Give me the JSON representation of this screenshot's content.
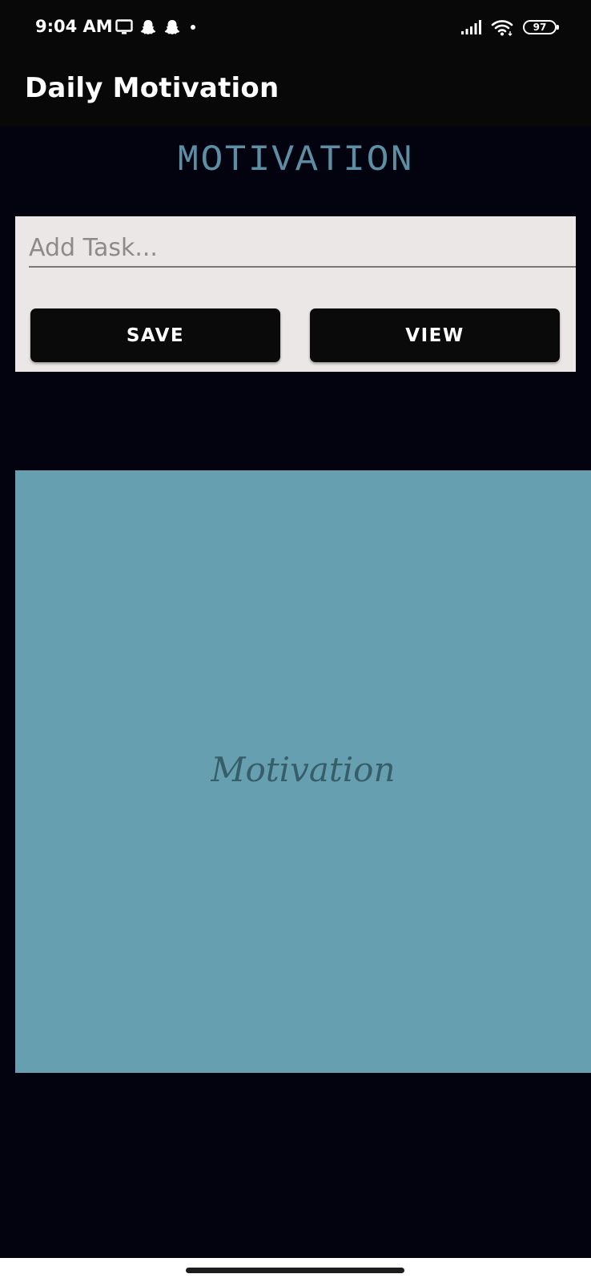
{
  "status_bar": {
    "time": "9:04 AM",
    "battery_level": "97",
    "left_icons": [
      "monitor-icon",
      "snapchat-ghost-icon",
      "snapchat-ghost-icon",
      "dot-icon"
    ],
    "right_icons": [
      "signal-bars-icon",
      "wifi-icon",
      "battery-icon"
    ]
  },
  "app_bar": {
    "title": "Daily Motivation"
  },
  "main": {
    "heading": "MOTIVATION",
    "task_input": {
      "placeholder": "Add Task...",
      "value": ""
    },
    "save_label": "SAVE",
    "view_label": "VIEW",
    "panel_text": "Motivation"
  },
  "colors": {
    "background": "#03020f",
    "bar": "#080808",
    "heading": "#5d8fa4",
    "card": "#ece7e7",
    "button": "#0a0a0a",
    "panel": "#66a0b0",
    "panel_text": "#375d68"
  }
}
